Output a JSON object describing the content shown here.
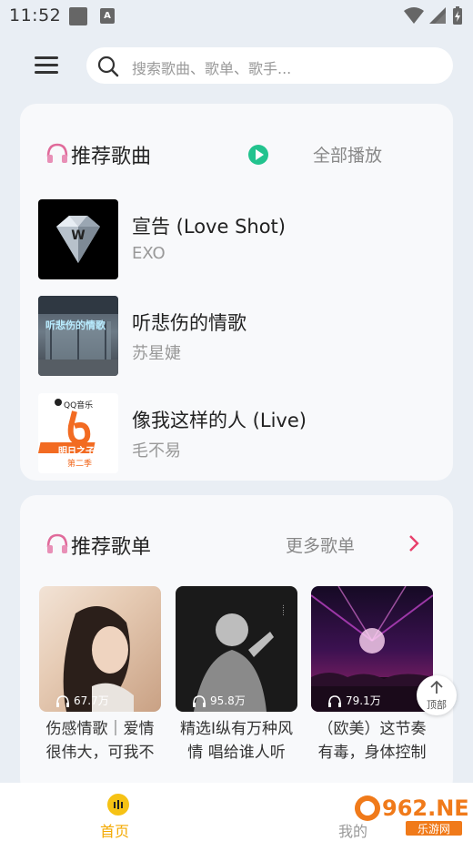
{
  "status_bar": {
    "time": "11:52",
    "notification_icon": "A"
  },
  "header": {
    "menu_icon": "menu-icon",
    "search_placeholder": "搜索歌曲、歌单、歌手..."
  },
  "recommended_songs": {
    "title": "推荐歌曲",
    "play_all_label": "全部播放",
    "songs": [
      {
        "title": "宣告 (Love Shot)",
        "artist": "EXO"
      },
      {
        "title": "听悲伤的情歌",
        "artist": "苏星婕",
        "cover_text": "听悲伤的情歌"
      },
      {
        "title": "像我这样的人 (Live)",
        "artist": "毛不易",
        "cover_text_top": "QQ音乐",
        "cover_text_mid": "明日之子",
        "cover_text_bottom": "第二季"
      }
    ]
  },
  "recommended_playlists": {
    "title": "推荐歌单",
    "more_label": "更多歌单",
    "playlists": [
      {
        "name": "伤感情歌｜爱情很伟大，可我不是他",
        "play_count": "67.7万"
      },
      {
        "name": "精选I纵有万种风情 唱给谁人听",
        "play_count": "95.8万"
      },
      {
        "name": "（欧美）这节奏有毒，身体控制不住了",
        "play_count": "79.1万"
      }
    ]
  },
  "back_to_top_label": "顶部",
  "bottom_nav": {
    "home_label": "首页",
    "mine_label": "我的"
  },
  "watermark": {
    "text": "962.NET",
    "subtext": "乐游网"
  },
  "colors": {
    "accent_green": "#22c38e",
    "accent_yellow": "#f6c214",
    "arrow_pink": "#e8406b"
  }
}
